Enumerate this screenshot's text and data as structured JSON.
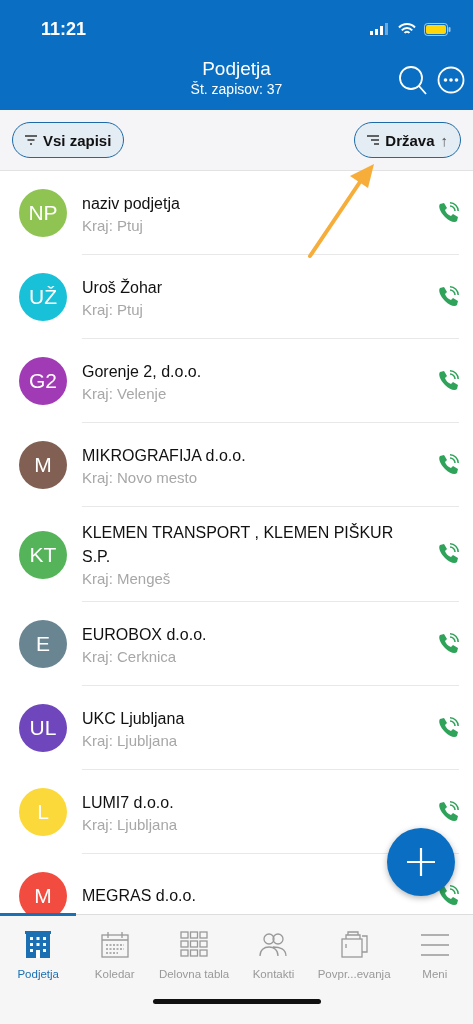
{
  "status_bar": {
    "time": "11:21"
  },
  "header": {
    "title": "Podjetja",
    "subtitle": "Št. zapisov: 37"
  },
  "filters": {
    "filter": "Vsi zapisi",
    "sort": "Država",
    "sort_arrow": "↑"
  },
  "companies": [
    {
      "initials": "NP",
      "color": "#8fc453",
      "name": "naziv podjetja",
      "place": "Kraj: Ptuj"
    },
    {
      "initials": "UŽ",
      "color": "#19c1d8",
      "name": "Uroš Žohar",
      "place": "Kraj: Ptuj"
    },
    {
      "initials": "G2",
      "color": "#a13bb5",
      "name": "Gorenje 2, d.o.o.",
      "place": "Kraj: Velenje"
    },
    {
      "initials": "M",
      "color": "#815f53",
      "name": "MIKROGRAFIJA d.o.o.",
      "place": "Kraj: Novo mesto"
    },
    {
      "initials": "KT",
      "color": "#55b45a",
      "name": "KLEMEN TRANSPORT , KLEMEN PIŠKUR S.P.",
      "place": "Kraj: Mengeš"
    },
    {
      "initials": "E",
      "color": "#6a8592",
      "name": "EUROBOX d.o.o.",
      "place": "Kraj: Cerknica"
    },
    {
      "initials": "UL",
      "color": "#6f46bc",
      "name": "UKC Ljubljana",
      "place": "Kraj: Ljubljana"
    },
    {
      "initials": "L",
      "color": "#fbd93a",
      "name": "LUMI7 d.o.o.",
      "place": "Kraj: Ljubljana"
    },
    {
      "initials": "M",
      "color": "#f14c3f",
      "name": "MEGRAS d.o.o."
    }
  ],
  "tabs": [
    {
      "kind": "building",
      "label": "Podjetja",
      "selected": true
    },
    {
      "kind": "calendar",
      "label": "Koledar",
      "selected": false
    },
    {
      "kind": "grid",
      "label": "Delovna tabla",
      "selected": false
    },
    {
      "kind": "people",
      "label": "Kontakti",
      "selected": false
    },
    {
      "kind": "briefcase",
      "label": "Povpr...evanja",
      "selected": false
    },
    {
      "kind": "menu",
      "label": "Meni",
      "selected": false
    }
  ]
}
